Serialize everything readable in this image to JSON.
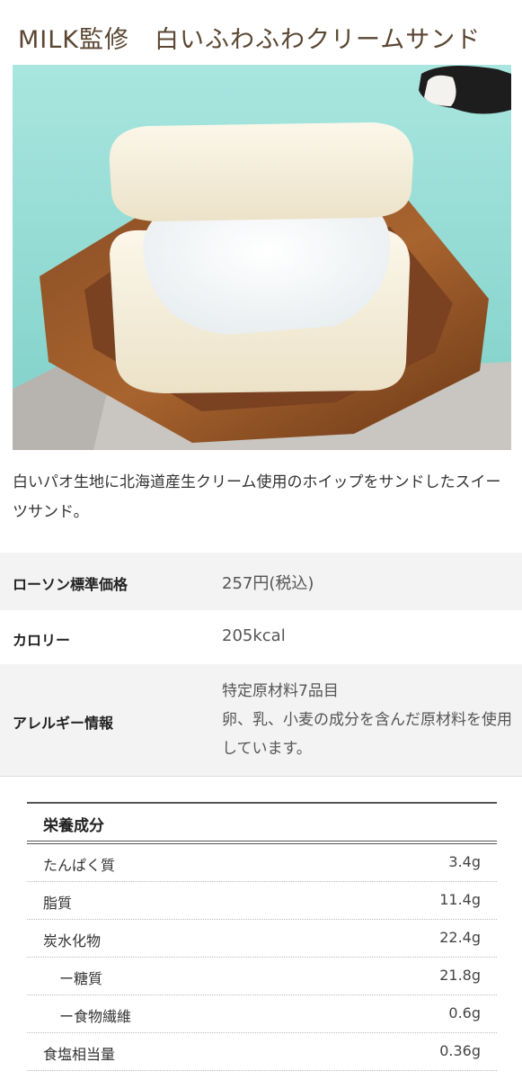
{
  "product": {
    "title": "MILK監修　白いふわふわクリームサンド",
    "description": "白いパオ生地に北海道産生クリーム使用のホイップをサンドしたスイーツサンド。"
  },
  "specs": [
    {
      "label": "ローソン標準価格",
      "value": "257円(税込)"
    },
    {
      "label": "カロリー",
      "value": "205kcal"
    },
    {
      "label": "アレルギー情報",
      "value": "特定原材料7品目\n卵、乳、小麦の成分を含んだ原材料を使用しています。"
    }
  ],
  "nutrition": {
    "header": "栄養成分",
    "rows": [
      {
        "label": "たんぱく質",
        "value": "3.4g"
      },
      {
        "label": "脂質",
        "value": "11.4g"
      },
      {
        "label": "炭水化物",
        "value": "22.4g"
      },
      {
        "label": "ー糖質",
        "value": "21.8g"
      },
      {
        "label": "ー食物繊維",
        "value": "0.6g"
      },
      {
        "label": "食塩相当量",
        "value": "0.36g"
      }
    ]
  }
}
